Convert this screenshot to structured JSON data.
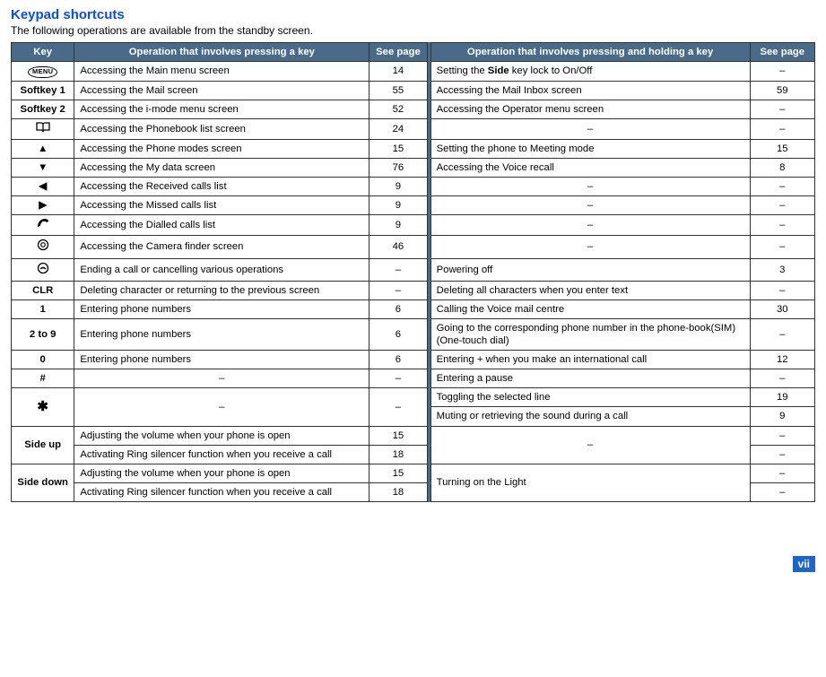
{
  "title": "Keypad shortcuts",
  "intro": "The following operations are available from the standby screen.",
  "headers": {
    "key": "Key",
    "op1": "Operation that involves pressing a key",
    "pg1": "See page",
    "op2": "Operation that involves pressing and holding a key",
    "pg2": "See page"
  },
  "rows": [
    {
      "key": "MENU",
      "icon": "menu-oval",
      "op1": "Accessing the Main menu screen",
      "pg1": "14",
      "op2": "Setting the Side key lock to On/Off",
      "op2bold": "Side",
      "pg2": "–"
    },
    {
      "key": "Softkey 1",
      "op1": "Accessing the Mail screen",
      "pg1": "55",
      "op2": "Accessing the Mail Inbox screen",
      "pg2": "59"
    },
    {
      "key": "Softkey 2",
      "op1": "Accessing the i-mode menu screen",
      "pg1": "52",
      "op2": "Accessing the Operator menu screen",
      "pg2": "–"
    },
    {
      "key": "book-icon",
      "icon": "phonebook",
      "op1": "Accessing the Phonebook list screen",
      "pg1": "24",
      "op2": "–",
      "center2": true,
      "pg2": "–"
    },
    {
      "key": "▲",
      "op1": "Accessing the Phone modes screen",
      "pg1": "15",
      "op2": "Setting the phone to Meeting mode",
      "pg2": "15"
    },
    {
      "key": "▼",
      "op1": "Accessing the My data screen",
      "pg1": "76",
      "op2": "Accessing the Voice recall",
      "pg2": "8"
    },
    {
      "key": "◀",
      "op1": "Accessing the Received calls list",
      "pg1": "9",
      "op2": "–",
      "center2": true,
      "pg2": "–"
    },
    {
      "key": "▶",
      "op1": "Accessing the Missed calls list",
      "pg1": "9",
      "op2": "–",
      "center2": true,
      "pg2": "–"
    },
    {
      "key": "dial-icon",
      "icon": "handset",
      "op1": "Accessing the Dialled calls list",
      "pg1": "9",
      "op2": "–",
      "center2": true,
      "pg2": "–"
    },
    {
      "key": "camera-icon",
      "icon": "camera",
      "op1": "Accessing the Camera finder screen",
      "pg1": "46",
      "op2": "–",
      "center2": true,
      "pg2": "–"
    },
    {
      "key": "end-icon",
      "icon": "endcall",
      "op1": "Ending a call or cancelling various operations",
      "pg1": "–",
      "op2": "Powering off",
      "pg2": "3"
    },
    {
      "key": "CLR",
      "op1": "Deleting character or returning to the previous screen",
      "pg1": "–",
      "op2": "Deleting all characters when you enter text",
      "pg2": "–"
    },
    {
      "key": "1",
      "op1": "Entering phone numbers",
      "pg1": "6",
      "op2": "Calling the Voice mail centre",
      "pg2": "30"
    },
    {
      "key": "2 to 9",
      "key_parts": [
        "2",
        " to ",
        "9"
      ],
      "op1": "Entering phone numbers",
      "pg1": "6",
      "op2": "Going to the corresponding phone number in the phone-book(SIM) (One-touch dial)",
      "pg2": "–"
    },
    {
      "key": "0",
      "op1": "Entering phone numbers",
      "pg1": "6",
      "op2": "Entering + when you make an international call",
      "pg2": "12"
    },
    {
      "key": "#",
      "op1": "–",
      "center1": true,
      "pg1": "–",
      "op2": "Entering a pause",
      "pg2": "–"
    }
  ],
  "star": {
    "key": "✱",
    "op1": "–",
    "pg1": "–",
    "op2a": "Toggling the selected line",
    "pg2a": "19",
    "op2b": "Muting or retrieving the sound during a call",
    "pg2b": "9"
  },
  "sideup": {
    "key": "Side up",
    "op1a": "Adjusting the volume when your phone is open",
    "pg1a": "15",
    "op1b": "Activating Ring silencer function when you receive a call",
    "pg1b": "18",
    "op2": "–",
    "pg2a": "–",
    "pg2b": "–"
  },
  "sidedown": {
    "key": "Side down",
    "op1a": "Adjusting the volume when your phone is open",
    "pg1a": "15",
    "op1b": "Activating Ring silencer function when you receive a call",
    "pg1b": "18",
    "op2": "Turning on the Light",
    "pg2a": "–",
    "pg2b": "–"
  },
  "page_number": "vii"
}
